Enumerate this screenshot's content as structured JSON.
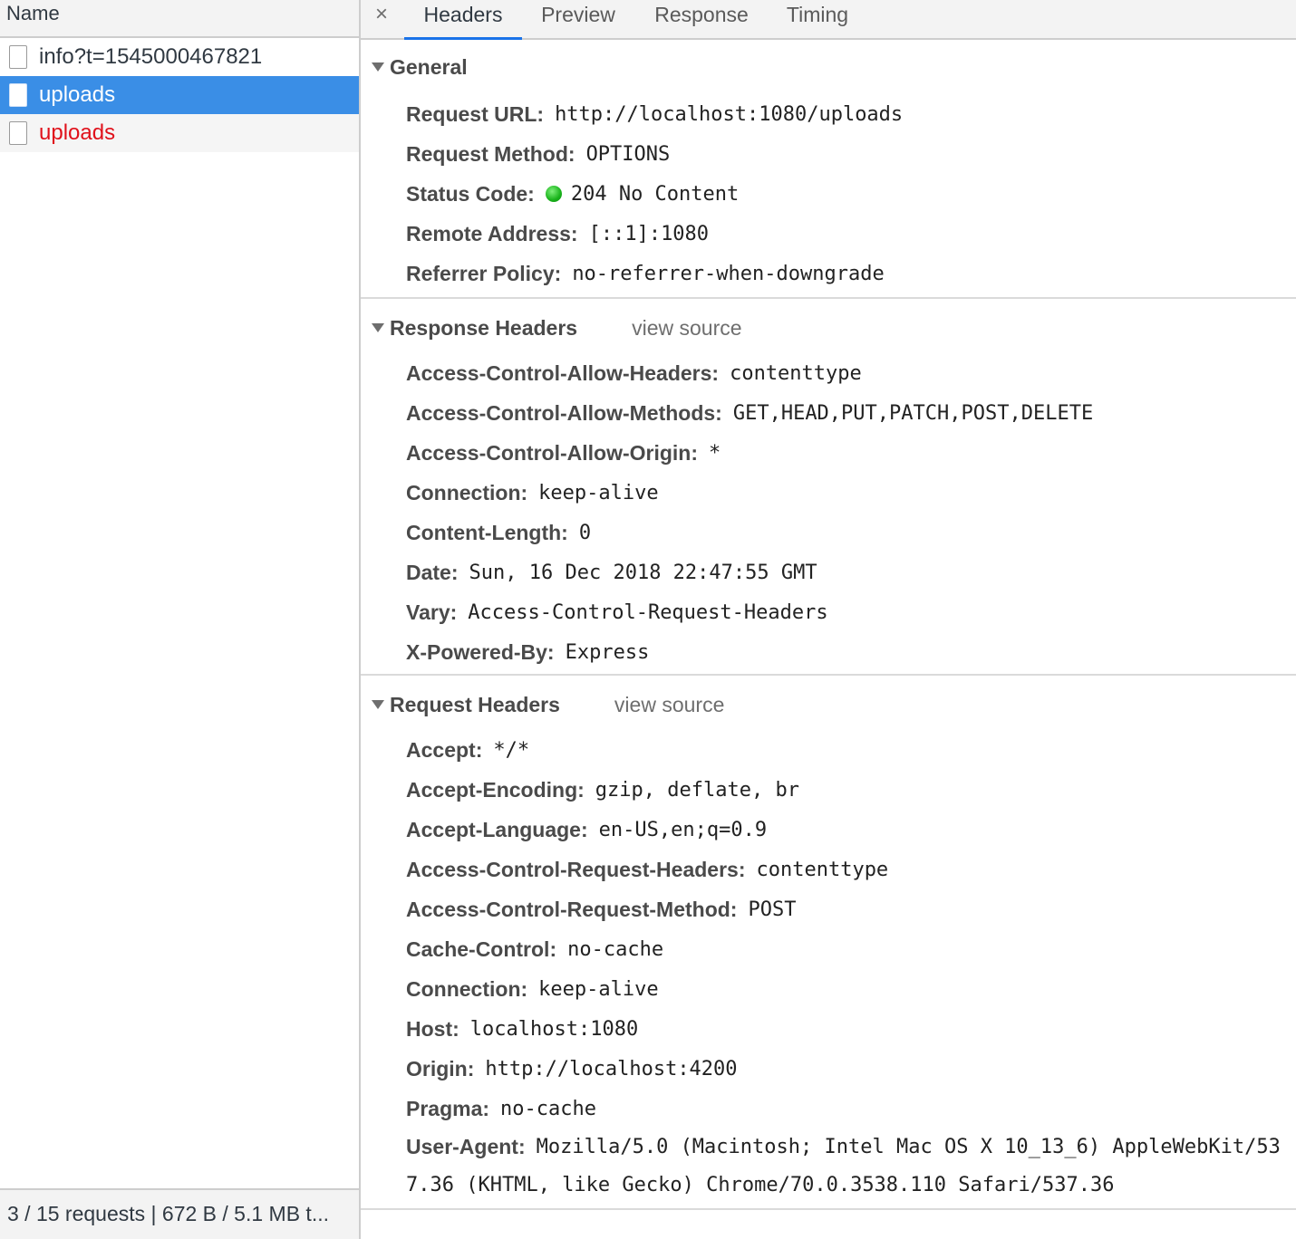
{
  "left": {
    "header": "Name",
    "requests": [
      {
        "name": "info?t=1545000467821"
      },
      {
        "name": "uploads"
      },
      {
        "name": "uploads"
      }
    ],
    "footer": "3 / 15 requests | 672 B / 5.1 MB t..."
  },
  "tabs": {
    "close": "×",
    "items": [
      "Headers",
      "Preview",
      "Response",
      "Timing"
    ]
  },
  "general": {
    "title": "General",
    "rows": [
      {
        "name": "Request URL:",
        "value": "http://localhost:1080/uploads"
      },
      {
        "name": "Request Method:",
        "value": "OPTIONS"
      },
      {
        "name": "Status Code:",
        "value": "204 No Content"
      },
      {
        "name": "Remote Address:",
        "value": "[::1]:1080"
      },
      {
        "name": "Referrer Policy:",
        "value": "no-referrer-when-downgrade"
      }
    ]
  },
  "response_headers": {
    "title": "Response Headers",
    "view_source": "view source",
    "rows": [
      {
        "name": "Access-Control-Allow-Headers:",
        "value": "contenttype"
      },
      {
        "name": "Access-Control-Allow-Methods:",
        "value": "GET,HEAD,PUT,PATCH,POST,DELETE"
      },
      {
        "name": "Access-Control-Allow-Origin:",
        "value": "*"
      },
      {
        "name": "Connection:",
        "value": "keep-alive"
      },
      {
        "name": "Content-Length:",
        "value": "0"
      },
      {
        "name": "Date:",
        "value": "Sun, 16 Dec 2018 22:47:55 GMT"
      },
      {
        "name": "Vary:",
        "value": "Access-Control-Request-Headers"
      },
      {
        "name": "X-Powered-By:",
        "value": "Express"
      }
    ]
  },
  "request_headers": {
    "title": "Request Headers",
    "view_source": "view source",
    "rows": [
      {
        "name": "Accept:",
        "value": "*/*"
      },
      {
        "name": "Accept-Encoding:",
        "value": "gzip, deflate, br"
      },
      {
        "name": "Accept-Language:",
        "value": "en-US,en;q=0.9"
      },
      {
        "name": "Access-Control-Request-Headers:",
        "value": "contenttype"
      },
      {
        "name": "Access-Control-Request-Method:",
        "value": "POST"
      },
      {
        "name": "Cache-Control:",
        "value": "no-cache"
      },
      {
        "name": "Connection:",
        "value": "keep-alive"
      },
      {
        "name": "Host:",
        "value": "localhost:1080"
      },
      {
        "name": "Origin:",
        "value": "http://localhost:4200"
      },
      {
        "name": "Pragma:",
        "value": "no-cache"
      }
    ],
    "user_agent": {
      "name": "User-Agent:",
      "value_line1": "Mozilla/5.0 (Macintosh; Intel Mac OS X 10_13_6) AppleWebKit/53",
      "value_line2": "7.36 (KHTML, like Gecko) Chrome/70.0.3538.110 Safari/537.36"
    }
  },
  "colors": {
    "accent": "#3a8ee6",
    "error": "#e0111b",
    "status_ok": "#18b21a",
    "tab_underline": "#1a73e8"
  }
}
